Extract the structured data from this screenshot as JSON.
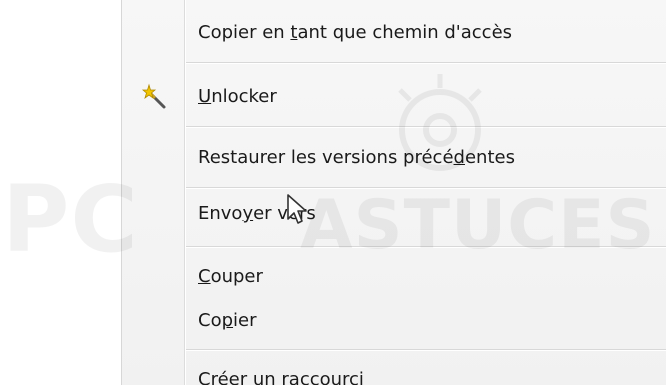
{
  "context_menu": {
    "items": [
      {
        "label": "Copier en tant que chemin d'accès",
        "accel_before": "Copier en ",
        "accel": "t",
        "accel_after": "ant que chemin d'accès"
      },
      {
        "label": "Unlocker",
        "accel_before": "",
        "accel": "U",
        "accel_after": "nlocker",
        "icon": "magic-wand-icon"
      },
      {
        "label": "Restaurer les versions précédentes",
        "accel_before": "Restaurer les versions précé",
        "accel": "d",
        "accel_after": "entes"
      },
      {
        "label": "Envoyer vers",
        "accel_before": "Envo",
        "accel": "y",
        "accel_after": "er vers"
      },
      {
        "label": "Couper",
        "accel_before": "",
        "accel": "C",
        "accel_after": "ouper"
      },
      {
        "label": "Copier",
        "accel_before": "Co",
        "accel": "p",
        "accel_after": "ier"
      },
      {
        "label": "Créer un raccourci",
        "accel_before": "Créer un raccourci",
        "accel": "",
        "accel_after": ""
      }
    ]
  },
  "watermark": {
    "left": "PC",
    "right": "ASTUCES"
  },
  "colors": {
    "menu_bg": "#f4f4f4",
    "separator": "#d8d8d8",
    "text": "#1a1a1a"
  }
}
